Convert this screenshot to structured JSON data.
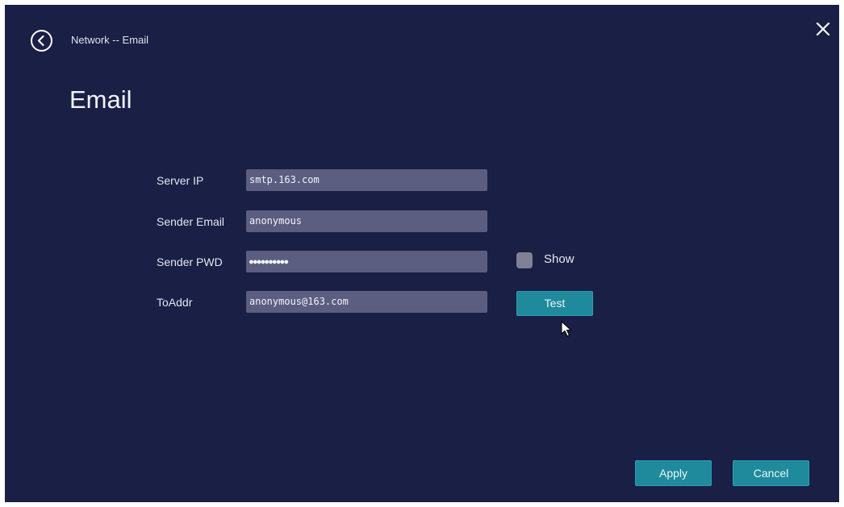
{
  "header": {
    "breadcrumb": "Network -- Email",
    "back_icon": "circle-chevron-left-icon",
    "close_icon": "close-icon"
  },
  "page": {
    "title": "Email"
  },
  "form": {
    "server_ip": {
      "label": "Server IP",
      "value": "smtp.163.com"
    },
    "sender_email": {
      "label": "Sender Email",
      "value": "anonymous"
    },
    "sender_pwd": {
      "label": "Sender PWD",
      "value": "●●●●●●●●●●"
    },
    "to_addr": {
      "label": "ToAddr",
      "value": "anonymous@163.com"
    },
    "show_checkbox": {
      "label": "Show",
      "checked": false
    },
    "test_button": "Test"
  },
  "footer": {
    "apply_label": "Apply",
    "cancel_label": "Cancel"
  },
  "colors": {
    "background": "#1a1f45",
    "field": "#5b5e80",
    "accent_button": "#1f8a9c",
    "checkbox": "#7f8296"
  }
}
